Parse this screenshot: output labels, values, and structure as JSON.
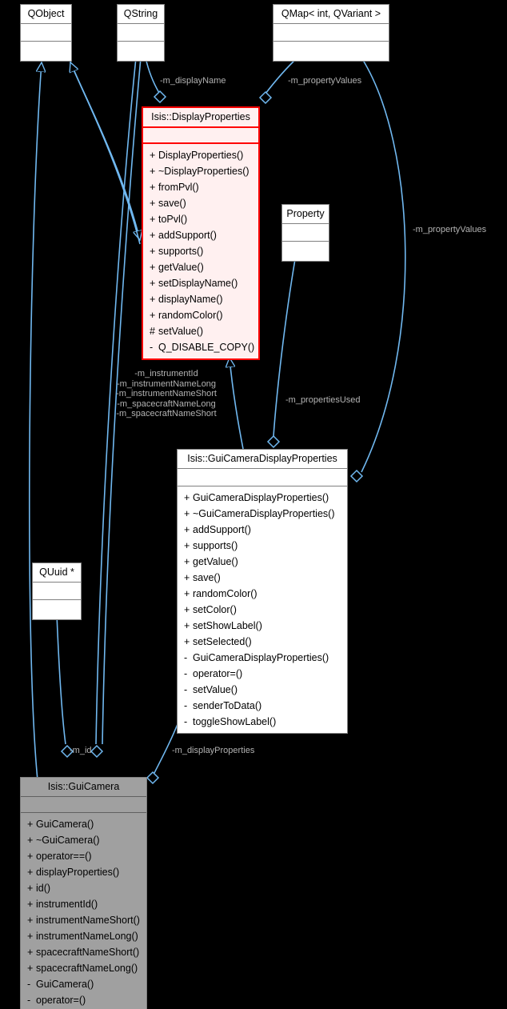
{
  "diagram": {
    "kind": "uml-class-collaboration-diagram",
    "background_color": "#000000",
    "edge_color": "#70b8f0",
    "edge_label_color": "#b3b3b3",
    "highlight_fill": "#a0a0a0",
    "current_fill": "#fff0f0",
    "current_border": "#ff0000"
  },
  "classes": {
    "qobject": {
      "name": "QObject",
      "attributes": [],
      "methods": []
    },
    "qstring": {
      "name": "QString",
      "attributes": [],
      "methods": []
    },
    "qmap": {
      "name": "QMap< int, QVariant >",
      "attributes": [],
      "methods": []
    },
    "property": {
      "name": "Property",
      "attributes": [],
      "methods": []
    },
    "quuid": {
      "name": "QUuid *",
      "attributes": [],
      "methods": []
    },
    "display_properties": {
      "name": "Isis::DisplayProperties",
      "attributes": [],
      "methods": [
        {
          "visibility": "+",
          "label": "DisplayProperties()"
        },
        {
          "visibility": "+",
          "label": "~DisplayProperties()"
        },
        {
          "visibility": "+",
          "label": "fromPvl()"
        },
        {
          "visibility": "+",
          "label": "save()"
        },
        {
          "visibility": "+",
          "label": "toPvl()"
        },
        {
          "visibility": "+",
          "label": "addSupport()"
        },
        {
          "visibility": "+",
          "label": "supports()"
        },
        {
          "visibility": "+",
          "label": "getValue()"
        },
        {
          "visibility": "+",
          "label": "setDisplayName()"
        },
        {
          "visibility": "+",
          "label": "displayName()"
        },
        {
          "visibility": "+",
          "label": "randomColor()"
        },
        {
          "visibility": "#",
          "label": "setValue()"
        },
        {
          "visibility": "-",
          "label": "Q_DISABLE_COPY()"
        }
      ]
    },
    "gui_camera_display_properties": {
      "name": "Isis::GuiCameraDisplayProperties",
      "attributes": [],
      "methods": [
        {
          "visibility": "+",
          "label": "GuiCameraDisplayProperties()"
        },
        {
          "visibility": "+",
          "label": "~GuiCameraDisplayProperties()"
        },
        {
          "visibility": "+",
          "label": "addSupport()"
        },
        {
          "visibility": "+",
          "label": "supports()"
        },
        {
          "visibility": "+",
          "label": "getValue()"
        },
        {
          "visibility": "+",
          "label": "save()"
        },
        {
          "visibility": "+",
          "label": "randomColor()"
        },
        {
          "visibility": "+",
          "label": "setColor()"
        },
        {
          "visibility": "+",
          "label": "setShowLabel()"
        },
        {
          "visibility": "+",
          "label": "setSelected()"
        },
        {
          "visibility": "-",
          "label": "GuiCameraDisplayProperties()"
        },
        {
          "visibility": "-",
          "label": "operator=()"
        },
        {
          "visibility": "-",
          "label": "setValue()"
        },
        {
          "visibility": "-",
          "label": "senderToData()"
        },
        {
          "visibility": "-",
          "label": "toggleShowLabel()"
        }
      ]
    },
    "gui_camera": {
      "name": "Isis::GuiCamera",
      "attributes": [],
      "methods": [
        {
          "visibility": "+",
          "label": "GuiCamera()"
        },
        {
          "visibility": "+",
          "label": "~GuiCamera()"
        },
        {
          "visibility": "+",
          "label": "operator==()"
        },
        {
          "visibility": "+",
          "label": "displayProperties()"
        },
        {
          "visibility": "+",
          "label": "id()"
        },
        {
          "visibility": "+",
          "label": "instrumentId()"
        },
        {
          "visibility": "+",
          "label": "instrumentNameShort()"
        },
        {
          "visibility": "+",
          "label": "instrumentNameLong()"
        },
        {
          "visibility": "+",
          "label": "spacecraftNameShort()"
        },
        {
          "visibility": "+",
          "label": "spacecraftNameLong()"
        },
        {
          "visibility": "-",
          "label": "GuiCamera()"
        },
        {
          "visibility": "-",
          "label": "operator=()"
        }
      ]
    }
  },
  "edge_labels": {
    "display_name": "-m_displayName",
    "property_values_left": "-m_propertyValues",
    "property_values_right": "-m_propertyValues",
    "instrument_fields": [
      "-m_instrumentId",
      "-m_instrumentNameLong",
      "-m_instrumentNameShort",
      "-m_spacecraftNameLong",
      "-m_spacecraftNameShort"
    ],
    "properties_used": "-m_propertiesUsed",
    "id": "-m_id",
    "display_properties": "-m_displayProperties"
  }
}
